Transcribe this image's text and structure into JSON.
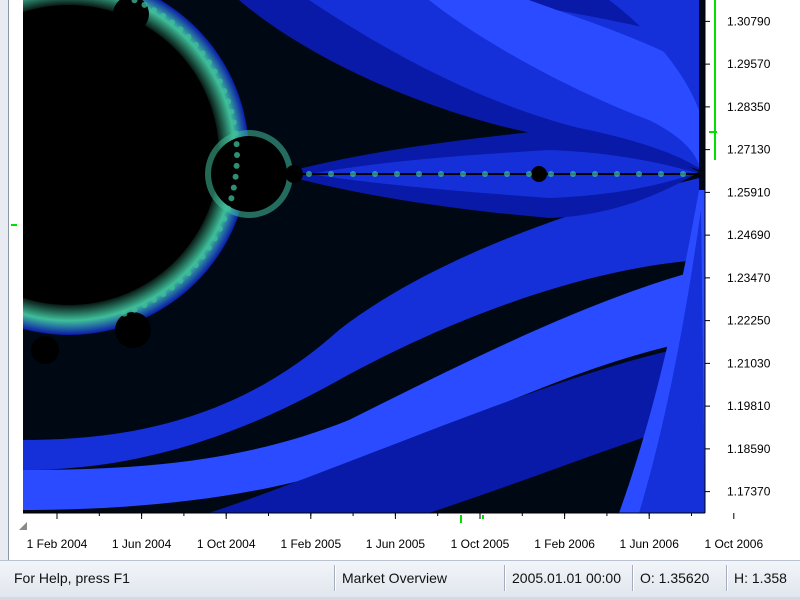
{
  "colors": {
    "chart_background": "#000814",
    "set_interior": "#000000",
    "band_dark": "#0a1aa8",
    "band_mid": "#1530d8",
    "band_bright": "#2a4bff",
    "edge_glow": "#3fbf9a",
    "marker_green": "#00e000",
    "axis_text": "#000000",
    "status_bar": "#e6ebf1"
  },
  "icons": {
    "price_marker": "green-tick-icon"
  },
  "chart_data": {
    "type": "line",
    "y_tick_labels": [
      "1.30790",
      "1.29570",
      "1.28350",
      "1.27130",
      "1.25910",
      "1.24690",
      "1.23470",
      "1.22250",
      "1.21030",
      "1.19810",
      "1.18590",
      "1.17370"
    ],
    "x_tick_labels": [
      "1 Feb 2004",
      "1 Jun 2004",
      "1 Oct 2004",
      "1 Feb 2005",
      "1 Jun 2005",
      "1 Oct 2005",
      "1 Feb 2006",
      "1 Jun 2006",
      "1 Oct 2006"
    ],
    "ylim": [
      1.1676,
      1.314
    ],
    "grid": false
  },
  "status": {
    "help": "For Help, press F1",
    "profile": "Market Overview",
    "datetime": "2005.01.01 00:00",
    "open": "O: 1.35620",
    "high": "H: 1.358"
  }
}
